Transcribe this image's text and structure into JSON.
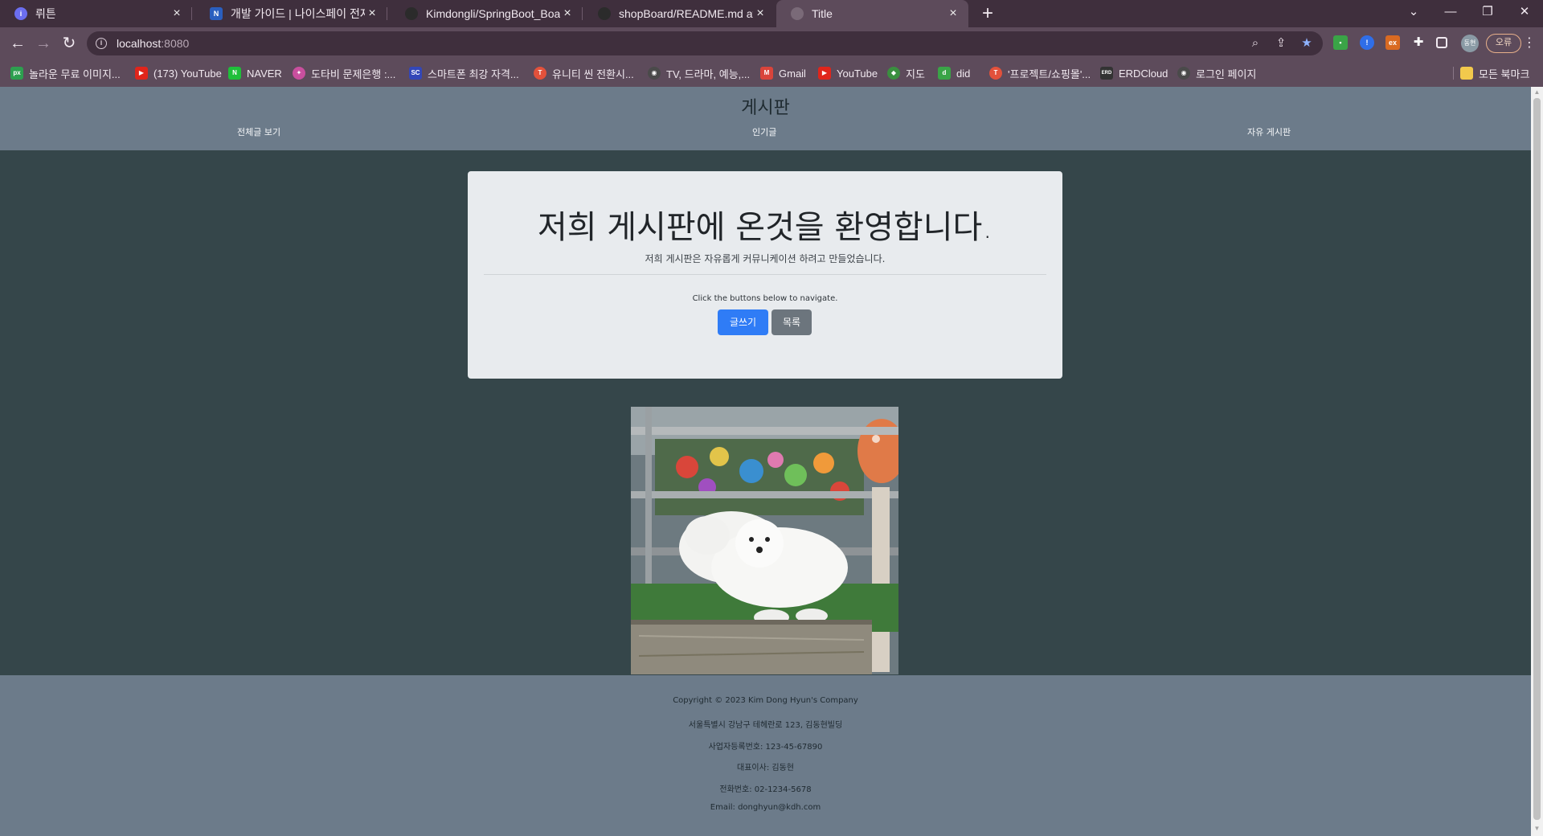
{
  "browser": {
    "tabs": [
      {
        "title": "뤼튼",
        "fav_color": "#6b6ef0"
      },
      {
        "title": "개발 가이드 | 나이스페이 전자결",
        "fav_color": "#2a5fbf"
      },
      {
        "title": "Kimdongli/SpringBoot_Board: 스",
        "fav_color": "#2b2b2b"
      },
      {
        "title": "shopBoard/README.md at mai",
        "fav_color": "#2b2b2b"
      },
      {
        "title": "Title",
        "fav_color": "#7a6a78"
      }
    ],
    "url_host": "localhost",
    "url_port": ":8080",
    "error_label": "오류",
    "bookmarks": [
      {
        "label": "놀라운 무료 이미지...",
        "color": "#2d9f4f",
        "glyph": "px"
      },
      {
        "label": "(173) YouTube",
        "color": "#e0251b",
        "glyph": "▶"
      },
      {
        "label": "NAVER",
        "color": "#1fbf3a",
        "glyph": "N"
      },
      {
        "label": "도타비 문제은행 :...",
        "color": "#c94f9e",
        "glyph": "✦"
      },
      {
        "label": "스마트폰 최강 자격...",
        "color": "#3347b8",
        "glyph": "SC"
      },
      {
        "label": "유니티 씬 전환시...",
        "color": "#e2513b",
        "glyph": "T"
      },
      {
        "label": "TV, 드라마, 예능,...",
        "color": "#4a4a4a",
        "glyph": "◉"
      },
      {
        "label": "Gmail",
        "color": "#d9443b",
        "glyph": "M"
      },
      {
        "label": "YouTube",
        "color": "#e0251b",
        "glyph": "▶"
      },
      {
        "label": "지도",
        "color": "#3a8f3f",
        "glyph": "◆"
      },
      {
        "label": "did",
        "color": "#3aa447",
        "glyph": "d"
      },
      {
        "label": "'프로젝트/쇼핑몰'...",
        "color": "#e2513b",
        "glyph": "T"
      },
      {
        "label": "ERDCloud",
        "color": "#333333",
        "glyph": "ERD"
      },
      {
        "label": "로그인 페이지",
        "color": "#4a4a4a",
        "glyph": "◉"
      }
    ],
    "all_bookmarks": "모든 북마크",
    "profile_label": "동현"
  },
  "site": {
    "title": "게시판",
    "nav": [
      "전체글 보기",
      "인기글",
      "자유 게시판"
    ]
  },
  "jumbotron": {
    "title": "저희 게시판에 온것을 환영합니다.",
    "lead": "저희 게시판은 자유롭게 커뮤니케이션 하려고 만들었습니다.",
    "note": "Click the buttons below to navigate.",
    "write_button": "글쓰기",
    "list_button": "목록"
  },
  "image": {
    "alt": "two white puppies behind a fence"
  },
  "footer": {
    "lines": [
      "Copyright © 2023 Kim Dong Hyun's Company",
      "서울특별시 강남구 테헤란로 123, 김동현빌딩",
      "사업자등록번호: 123-45-67890",
      "대표이사: 김동현",
      "전화번호: 02-1234-5678",
      "Email: donghyun@kdh.com"
    ]
  },
  "colors": {
    "header_bg": "#6c7b8a",
    "body_bg": "#35464a",
    "primary": "#2f7cf6",
    "secondary": "#6c757d"
  }
}
